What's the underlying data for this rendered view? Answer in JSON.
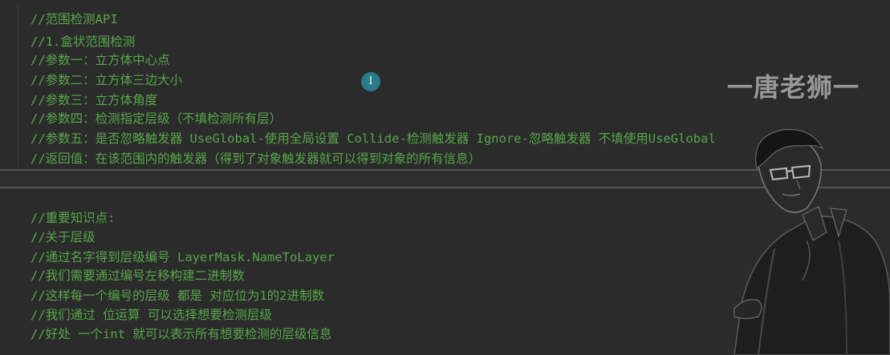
{
  "editor": {
    "lines_top": [
      "//范围检测API",
      "//1.盒状范围检测",
      "//参数一：立方体中心点",
      "//参数二：立方体三边大小",
      "//参数三：立方体角度",
      "//参数四：检测指定层级（不填检测所有层）",
      "//参数五：是否忽略触发器 UseGlobal-使用全局设置 Collide-检测触发器 Ignore-忽略触发器 不填使用UseGlobal",
      "//返回值：在该范围内的触发器（得到了对象触发器就可以得到对象的所有信息）"
    ],
    "lines_bottom": [
      "//重要知识点:",
      "//关于层级",
      "//通过名字得到层级编号 LayerMask.NameToLayer",
      "//我们需要通过编号左移构建二进制数",
      "//这样每一个编号的层级 都是 对应位为1的2进制数",
      "//我们通过 位运算 可以选择想要检测层级",
      "//好处 一个int 就可以表示所有想要检测的层级信息"
    ],
    "cursor_glyph": "I"
  },
  "watermark": {
    "text": "一唐老狮一"
  },
  "colors": {
    "background": "#2b2b2b",
    "comment": "#57a64a",
    "separator": "#555555"
  }
}
